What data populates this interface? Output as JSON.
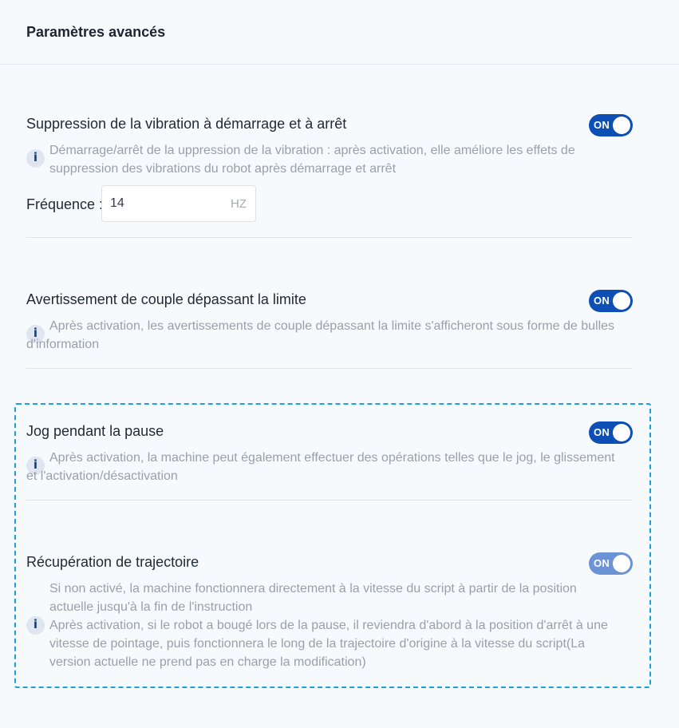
{
  "header": {
    "title": "Paramètres avancés"
  },
  "sections": {
    "vibration": {
      "title": "Suppression de la vibration à démarrage et à arrêt",
      "toggle": "ON",
      "desc_line1": "Démarrage/arrêt de la uppression de la vibration : après activation, elle améliore les effets de",
      "desc_line2": "suppression des vibrations du robot après démarrage et arrêt",
      "frequency_label": "Fréquence :",
      "frequency_value": "14",
      "frequency_unit": "HZ"
    },
    "torque": {
      "title": "Avertissement de couple dépassant la limite",
      "toggle": "ON",
      "desc_line1": "Après activation, les avertissements de couple dépassant la limite s'afficheront sous forme de bulles",
      "desc_line2": "d'information"
    },
    "jog": {
      "title": "Jog pendant la pause",
      "toggle": "ON",
      "desc_line1": "Après activation, la machine peut également effectuer des opérations telles que le jog, le glissement",
      "desc_line2": "et l'activation/désactivation"
    },
    "trajectory": {
      "title": "Récupération de trajectoire",
      "toggle": "ON",
      "desc_line1": "Si non activé, la machine fonctionnera directement à la vitesse du script à partir de la position",
      "desc_line2": "actuelle jusqu'à la fin de l'instruction",
      "desc_line3": "Après activation, si le robot a bougé lors de la pause, il reviendra d'abord à la position d'arrêt à une",
      "desc_line4": "vitesse de pointage, puis fonctionnera le long de la trajectoire d'origine à la vitesse du script(La",
      "desc_line5": "version actuelle ne prend pas en charge la modification)"
    }
  },
  "colors": {
    "toggle_on": "#0d4fb5",
    "toggle_disabled": "#6c93d4",
    "highlight_border": "#1ea0e0",
    "background": "#f6fafd"
  },
  "icons": {
    "info": "info-icon"
  }
}
